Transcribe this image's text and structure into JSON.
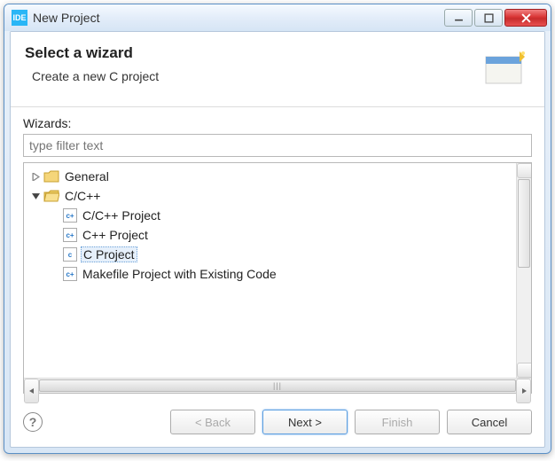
{
  "window": {
    "app_icon_text": "IDE",
    "title": "New Project"
  },
  "header": {
    "title": "Select a wizard",
    "subtitle": "Create a new C project"
  },
  "content": {
    "wizards_label": "Wizards:",
    "filter_placeholder": "type filter text"
  },
  "tree": {
    "items": [
      {
        "label": "General",
        "level": 0,
        "expanded": false,
        "type": "folder"
      },
      {
        "label": "C/C++",
        "level": 0,
        "expanded": true,
        "type": "folder"
      },
      {
        "label": "C/C++ Project",
        "level": 1,
        "type": "file"
      },
      {
        "label": "C++ Project",
        "level": 1,
        "type": "file"
      },
      {
        "label": "C Project",
        "level": 1,
        "type": "file",
        "selected": true
      },
      {
        "label": "Makefile Project with Existing Code",
        "level": 1,
        "type": "file"
      }
    ]
  },
  "buttons": {
    "back": "< Back",
    "next": "Next >",
    "finish": "Finish",
    "cancel": "Cancel"
  }
}
